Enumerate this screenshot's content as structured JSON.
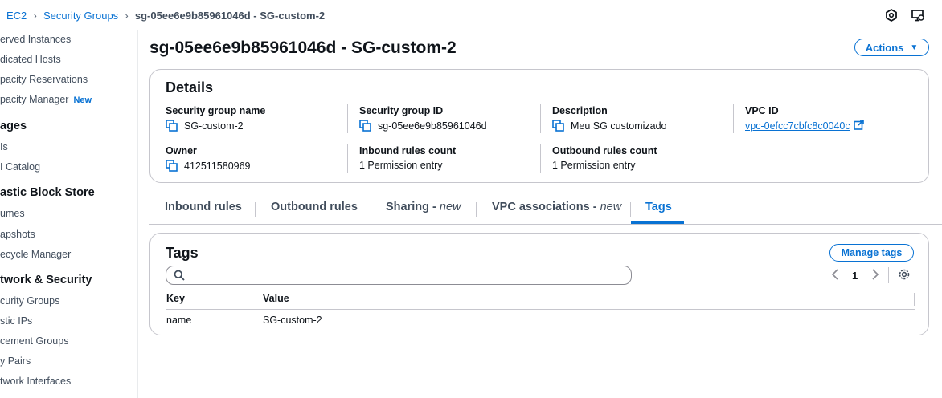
{
  "breadcrumb": {
    "items": [
      "EC2",
      "Security Groups"
    ],
    "current": "sg-05ee6e9b85961046d - SG-custom-2"
  },
  "sidebar": {
    "items": [
      {
        "label": "erved Instances",
        "type": "item"
      },
      {
        "label": "dicated Hosts",
        "type": "item"
      },
      {
        "label": "pacity Reservations",
        "type": "item"
      },
      {
        "label": "pacity Manager",
        "type": "item",
        "badge": "New"
      },
      {
        "label": "ages",
        "type": "section"
      },
      {
        "label": "Is",
        "type": "item"
      },
      {
        "label": "I Catalog",
        "type": "item"
      },
      {
        "label": "astic Block Store",
        "type": "section"
      },
      {
        "label": "umes",
        "type": "item"
      },
      {
        "label": "apshots",
        "type": "item"
      },
      {
        "label": "ecycle Manager",
        "type": "item"
      },
      {
        "label": "twork & Security",
        "type": "section"
      },
      {
        "label": "curity Groups",
        "type": "item"
      },
      {
        "label": "stic IPs",
        "type": "item"
      },
      {
        "label": "cement Groups",
        "type": "item"
      },
      {
        "label": "y Pairs",
        "type": "item"
      },
      {
        "label": "twork Interfaces",
        "type": "item"
      }
    ]
  },
  "page": {
    "title": "sg-05ee6e9b85961046d - SG-custom-2",
    "actions_label": "Actions"
  },
  "details": {
    "title": "Details",
    "fields": {
      "sg_name": {
        "label": "Security group name",
        "value": "SG-custom-2"
      },
      "sg_id": {
        "label": "Security group ID",
        "value": "sg-05ee6e9b85961046d"
      },
      "description": {
        "label": "Description",
        "value": "Meu SG customizado"
      },
      "vpc_id": {
        "label": "VPC ID",
        "value": "vpc-0efcc7cbfc8c0040c"
      },
      "owner": {
        "label": "Owner",
        "value": "412511580969"
      },
      "inbound_count": {
        "label": "Inbound rules count",
        "value": "1 Permission entry"
      },
      "outbound_count": {
        "label": "Outbound rules count",
        "value": "1 Permission entry"
      }
    }
  },
  "tabs": [
    {
      "label": "Inbound rules",
      "suffix": ""
    },
    {
      "label": "Outbound rules",
      "suffix": ""
    },
    {
      "label": "Sharing - ",
      "suffix": "new"
    },
    {
      "label": "VPC associations - ",
      "suffix": "new"
    },
    {
      "label": "Tags",
      "suffix": "",
      "active": true
    }
  ],
  "tags_panel": {
    "title": "Tags",
    "manage_label": "Manage tags",
    "search_placeholder": "",
    "page_number": "1",
    "columns": [
      "Key",
      "Value"
    ],
    "rows": [
      {
        "key": "name",
        "value": "SG-custom-2"
      }
    ]
  },
  "colors": {
    "accent": "#0972d3",
    "text": "#0f141a",
    "border": "#c6c6cd"
  }
}
